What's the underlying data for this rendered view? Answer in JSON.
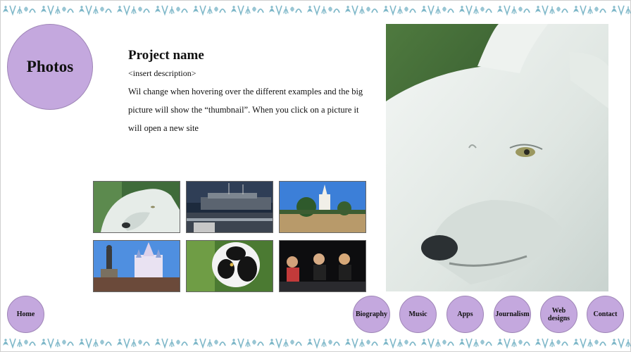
{
  "title_circle": {
    "label": "Photos"
  },
  "project": {
    "name": "Project name",
    "placeholder": "<insert description>",
    "description": "Wil change when hovering over the different examples and the big picture will show the “thumbnail”. When you click on a picture it will open a new site"
  },
  "thumbnails": [
    {
      "name": "thumb-wolf",
      "subject": "white wolf"
    },
    {
      "name": "thumb-ship",
      "subject": "ship at dock"
    },
    {
      "name": "thumb-cathedral",
      "subject": "cathedral square"
    },
    {
      "name": "thumb-castle",
      "subject": "castle with statue"
    },
    {
      "name": "thumb-lemur",
      "subject": "black and white lemur"
    },
    {
      "name": "thumb-panel",
      "subject": "panel on stage"
    }
  ],
  "hero": {
    "subject": "white wolf close-up"
  },
  "nav": {
    "home": "Home",
    "biography": "Biography",
    "music": "Music",
    "apps": "Apps",
    "journalism": "Journalism",
    "webdesigns": "Web designs",
    "contact": "Contact"
  },
  "colors": {
    "circle_fill": "#c4a8de",
    "border_ornament": "#7fb8c9"
  }
}
